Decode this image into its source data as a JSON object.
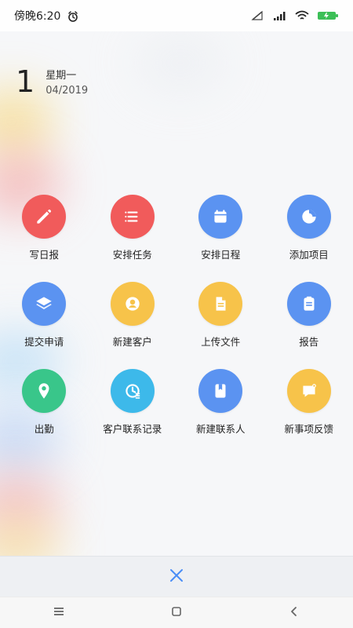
{
  "status_bar": {
    "time": "傍晚6:20",
    "icons": [
      "alarm-icon",
      "no-sim-icon",
      "cellular-signal-icon",
      "wifi-icon",
      "battery-charging-icon"
    ]
  },
  "date": {
    "day": "1",
    "weekday": "星期一",
    "month_year": "04/2019"
  },
  "menu": {
    "items": [
      {
        "label": "写日报",
        "icon": "pencil-icon",
        "color": "#f15b5b"
      },
      {
        "label": "安排任务",
        "icon": "list-icon",
        "color": "#f15b5b"
      },
      {
        "label": "安排日程",
        "icon": "calendar-icon",
        "color": "#5b93f1"
      },
      {
        "label": "添加项目",
        "icon": "project-icon",
        "color": "#5b93f1"
      },
      {
        "label": "提交申请",
        "icon": "layers-icon",
        "color": "#5b93f1"
      },
      {
        "label": "新建客户",
        "icon": "user-icon",
        "color": "#f7c34a"
      },
      {
        "label": "上传文件",
        "icon": "document-icon",
        "color": "#f7c34a"
      },
      {
        "label": "报告",
        "icon": "clipboard-icon",
        "color": "#5b93f1"
      },
      {
        "label": "出勤",
        "icon": "location-pin-icon",
        "color": "#39c68a"
      },
      {
        "label": "客户联系记录",
        "icon": "contact-history-icon",
        "color": "#3db9ea"
      },
      {
        "label": "新建联系人",
        "icon": "address-book-icon",
        "color": "#5b93f1"
      },
      {
        "label": "新事项反馈",
        "icon": "feedback-icon",
        "color": "#f7c34a"
      }
    ]
  },
  "close": {
    "icon": "close-icon",
    "color": "#4a8df6"
  },
  "nav": {
    "icons": [
      "menu-icon",
      "home-icon",
      "back-icon"
    ]
  }
}
